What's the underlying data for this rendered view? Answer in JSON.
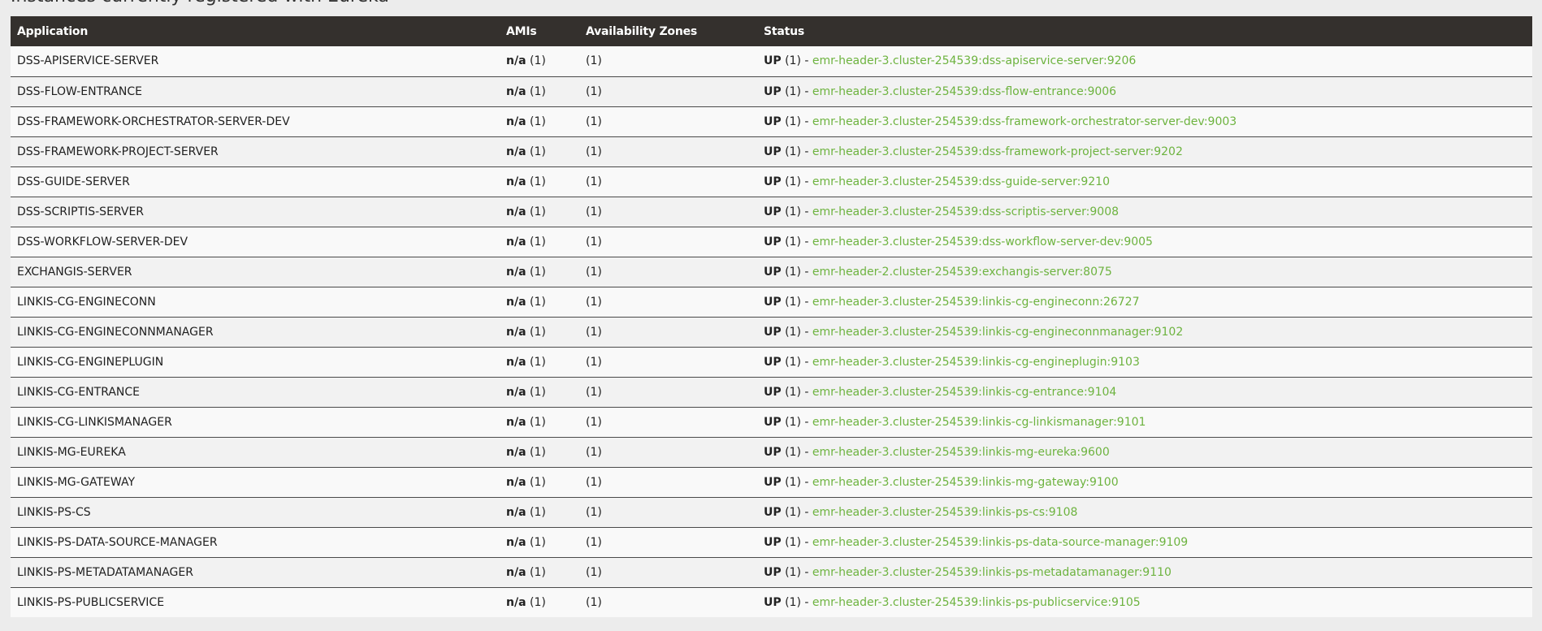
{
  "section_heading": "Instances currently registered with Eureka",
  "table": {
    "headers": {
      "application": "Application",
      "amis": "AMIs",
      "availability_zones": "Availability Zones",
      "status": "Status"
    },
    "rows": [
      {
        "application": "DSS-APISERVICE-SERVER",
        "amis": "n/a",
        "amis_count": "(1)",
        "zones": "(1)",
        "status": "UP",
        "status_count": "(1)",
        "separator": "-",
        "instance": "emr-header-3.cluster-254539:dss-apiservice-server:9206"
      },
      {
        "application": "DSS-FLOW-ENTRANCE",
        "amis": "n/a",
        "amis_count": "(1)",
        "zones": "(1)",
        "status": "UP",
        "status_count": "(1)",
        "separator": "-",
        "instance": "emr-header-3.cluster-254539:dss-flow-entrance:9006"
      },
      {
        "application": "DSS-FRAMEWORK-ORCHESTRATOR-SERVER-DEV",
        "amis": "n/a",
        "amis_count": "(1)",
        "zones": "(1)",
        "status": "UP",
        "status_count": "(1)",
        "separator": "-",
        "instance": "emr-header-3.cluster-254539:dss-framework-orchestrator-server-dev:9003"
      },
      {
        "application": "DSS-FRAMEWORK-PROJECT-SERVER",
        "amis": "n/a",
        "amis_count": "(1)",
        "zones": "(1)",
        "status": "UP",
        "status_count": "(1)",
        "separator": "-",
        "instance": "emr-header-3.cluster-254539:dss-framework-project-server:9202"
      },
      {
        "application": "DSS-GUIDE-SERVER",
        "amis": "n/a",
        "amis_count": "(1)",
        "zones": "(1)",
        "status": "UP",
        "status_count": "(1)",
        "separator": "-",
        "instance": "emr-header-3.cluster-254539:dss-guide-server:9210"
      },
      {
        "application": "DSS-SCRIPTIS-SERVER",
        "amis": "n/a",
        "amis_count": "(1)",
        "zones": "(1)",
        "status": "UP",
        "status_count": "(1)",
        "separator": "-",
        "instance": "emr-header-3.cluster-254539:dss-scriptis-server:9008"
      },
      {
        "application": "DSS-WORKFLOW-SERVER-DEV",
        "amis": "n/a",
        "amis_count": "(1)",
        "zones": "(1)",
        "status": "UP",
        "status_count": "(1)",
        "separator": "-",
        "instance": "emr-header-3.cluster-254539:dss-workflow-server-dev:9005"
      },
      {
        "application": "EXCHANGIS-SERVER",
        "amis": "n/a",
        "amis_count": "(1)",
        "zones": "(1)",
        "status": "UP",
        "status_count": "(1)",
        "separator": "-",
        "instance": "emr-header-2.cluster-254539:exchangis-server:8075"
      },
      {
        "application": "LINKIS-CG-ENGINECONN",
        "amis": "n/a",
        "amis_count": "(1)",
        "zones": "(1)",
        "status": "UP",
        "status_count": "(1)",
        "separator": "-",
        "instance": "emr-header-3.cluster-254539:linkis-cg-engineconn:26727"
      },
      {
        "application": "LINKIS-CG-ENGINECONNMANAGER",
        "amis": "n/a",
        "amis_count": "(1)",
        "zones": "(1)",
        "status": "UP",
        "status_count": "(1)",
        "separator": "-",
        "instance": "emr-header-3.cluster-254539:linkis-cg-engineconnmanager:9102"
      },
      {
        "application": "LINKIS-CG-ENGINEPLUGIN",
        "amis": "n/a",
        "amis_count": "(1)",
        "zones": "(1)",
        "status": "UP",
        "status_count": "(1)",
        "separator": "-",
        "instance": "emr-header-3.cluster-254539:linkis-cg-engineplugin:9103"
      },
      {
        "application": "LINKIS-CG-ENTRANCE",
        "amis": "n/a",
        "amis_count": "(1)",
        "zones": "(1)",
        "status": "UP",
        "status_count": "(1)",
        "separator": "-",
        "instance": "emr-header-3.cluster-254539:linkis-cg-entrance:9104"
      },
      {
        "application": "LINKIS-CG-LINKISMANAGER",
        "amis": "n/a",
        "amis_count": "(1)",
        "zones": "(1)",
        "status": "UP",
        "status_count": "(1)",
        "separator": "-",
        "instance": "emr-header-3.cluster-254539:linkis-cg-linkismanager:9101"
      },
      {
        "application": "LINKIS-MG-EUREKA",
        "amis": "n/a",
        "amis_count": "(1)",
        "zones": "(1)",
        "status": "UP",
        "status_count": "(1)",
        "separator": "-",
        "instance": "emr-header-3.cluster-254539:linkis-mg-eureka:9600"
      },
      {
        "application": "LINKIS-MG-GATEWAY",
        "amis": "n/a",
        "amis_count": "(1)",
        "zones": "(1)",
        "status": "UP",
        "status_count": "(1)",
        "separator": "-",
        "instance": "emr-header-3.cluster-254539:linkis-mg-gateway:9100"
      },
      {
        "application": "LINKIS-PS-CS",
        "amis": "n/a",
        "amis_count": "(1)",
        "zones": "(1)",
        "status": "UP",
        "status_count": "(1)",
        "separator": "-",
        "instance": "emr-header-3.cluster-254539:linkis-ps-cs:9108"
      },
      {
        "application": "LINKIS-PS-DATA-SOURCE-MANAGER",
        "amis": "n/a",
        "amis_count": "(1)",
        "zones": "(1)",
        "status": "UP",
        "status_count": "(1)",
        "separator": "-",
        "instance": "emr-header-3.cluster-254539:linkis-ps-data-source-manager:9109"
      },
      {
        "application": "LINKIS-PS-METADATAMANAGER",
        "amis": "n/a",
        "amis_count": "(1)",
        "zones": "(1)",
        "status": "UP",
        "status_count": "(1)",
        "separator": "-",
        "instance": "emr-header-3.cluster-254539:linkis-ps-metadatamanager:9110"
      },
      {
        "application": "LINKIS-PS-PUBLICSERVICE",
        "amis": "n/a",
        "amis_count": "(1)",
        "zones": "(1)",
        "status": "UP",
        "status_count": "(1)",
        "separator": "-",
        "instance": "emr-header-3.cluster-254539:linkis-ps-publicservice:9105"
      }
    ]
  },
  "colors": {
    "header_bg": "#34302d",
    "link": "#6db33f",
    "page_bg": "#ececec",
    "row_odd": "#f9f9f9",
    "row_even": "#f2f2f2"
  }
}
